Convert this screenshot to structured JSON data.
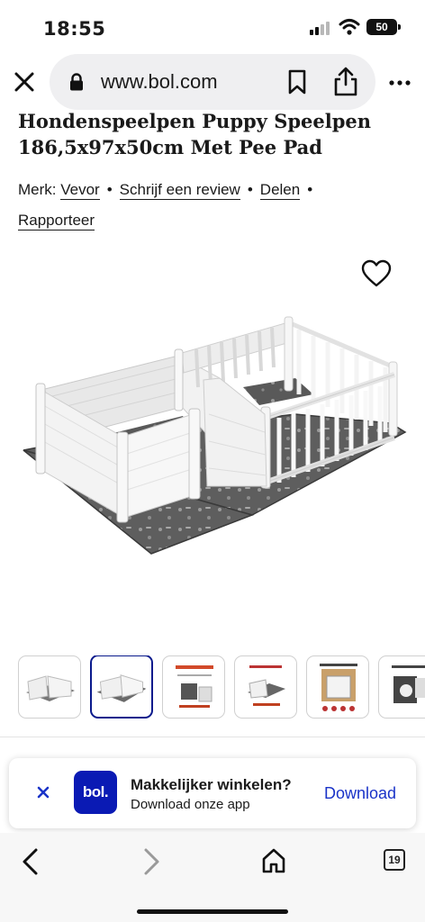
{
  "status_bar": {
    "time": "18:55",
    "battery": "50"
  },
  "browser": {
    "url": "www.bol.com",
    "icons": [
      "close-icon",
      "lock-icon",
      "bookmark-icon",
      "share-icon",
      "more-icon"
    ]
  },
  "product": {
    "title": "Hondenspeelpen Puppy Speelpen 186,5x97x50cm Met Pee Pad",
    "brand_label": "Merk:",
    "brand": "Vevor",
    "review_link": "Schrijf een review",
    "share_link": "Delen",
    "report_link": "Rapporteer",
    "separator": "•"
  },
  "thumbnails": {
    "count": 6,
    "selected_index": 1
  },
  "app_banner": {
    "logo": "bol.",
    "title": "Makkelijker winkelen?",
    "subtitle": "Download onze app",
    "cta": "Download",
    "accent_color": "#0a1ab4"
  },
  "bottom_nav": {
    "tab_count": "19",
    "icons": [
      "back-icon",
      "forward-icon",
      "home-icon",
      "tabs-icon"
    ]
  }
}
